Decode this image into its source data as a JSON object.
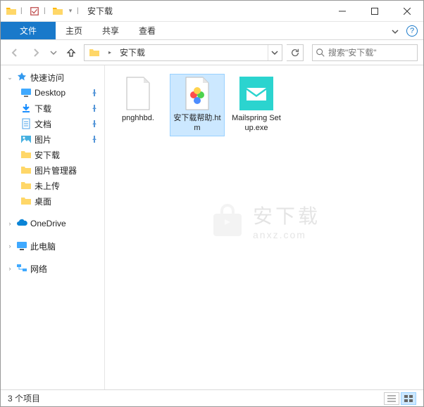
{
  "window": {
    "title": "安下载"
  },
  "tabs": {
    "file": "文件",
    "home": "主页",
    "share": "共享",
    "view": "查看"
  },
  "address": {
    "folder": "安下载"
  },
  "search": {
    "placeholder": "搜索\"安下载\""
  },
  "sidebar": {
    "quick_access": "快速访问",
    "items": [
      {
        "label": "Desktop",
        "pinned": true,
        "icon": "desktop"
      },
      {
        "label": "下载",
        "pinned": true,
        "icon": "download"
      },
      {
        "label": "文档",
        "pinned": true,
        "icon": "document"
      },
      {
        "label": "图片",
        "pinned": true,
        "icon": "pictures"
      },
      {
        "label": "安下载",
        "pinned": false,
        "icon": "folder"
      },
      {
        "label": "图片管理器",
        "pinned": false,
        "icon": "folder"
      },
      {
        "label": "未上传",
        "pinned": false,
        "icon": "folder"
      },
      {
        "label": "桌面",
        "pinned": false,
        "icon": "folder"
      }
    ],
    "onedrive": "OneDrive",
    "this_pc": "此电脑",
    "network": "网络"
  },
  "files": [
    {
      "name": "pnghhbd.",
      "type": "file",
      "selected": false
    },
    {
      "name": "安下载帮助.htm",
      "type": "htm",
      "selected": true
    },
    {
      "name": "Mailspring Setup.exe",
      "type": "exe-mail",
      "selected": false
    }
  ],
  "status": {
    "count": "3 个项目"
  },
  "watermark": {
    "cn": "安下载",
    "en": "anxz.com"
  }
}
